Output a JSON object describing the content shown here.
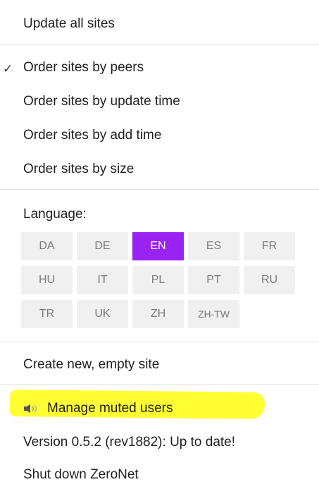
{
  "menu": {
    "update_all": "Update all sites",
    "sort_options": [
      {
        "label": "Order sites by peers",
        "selected": true
      },
      {
        "label": "Order sites by update time",
        "selected": false
      },
      {
        "label": "Order sites by add time",
        "selected": false
      },
      {
        "label": "Order sites by size",
        "selected": false
      }
    ],
    "check_mark": "✓",
    "language_label": "Language:",
    "languages": [
      {
        "code": "DA",
        "active": false
      },
      {
        "code": "DE",
        "active": false
      },
      {
        "code": "EN",
        "active": true
      },
      {
        "code": "ES",
        "active": false
      },
      {
        "code": "FR",
        "active": false
      },
      {
        "code": "HU",
        "active": false
      },
      {
        "code": "IT",
        "active": false
      },
      {
        "code": "PL",
        "active": false
      },
      {
        "code": "PT",
        "active": false
      },
      {
        "code": "RU",
        "active": false
      },
      {
        "code": "TR",
        "active": false
      },
      {
        "code": "UK",
        "active": false
      },
      {
        "code": "ZH",
        "active": false
      },
      {
        "code": "ZH-TW",
        "active": false
      }
    ],
    "create_site": "Create new, empty site",
    "manage_muted": "Manage muted users",
    "mute_icon": "speaker-muted-icon",
    "version": "Version 0.5.2 (rev1882): Up to date!",
    "shutdown": "Shut down ZeroNet"
  },
  "colors": {
    "accent": "#9b22f4",
    "highlight": "#ffff33",
    "button_bg": "#f0f0f0"
  }
}
